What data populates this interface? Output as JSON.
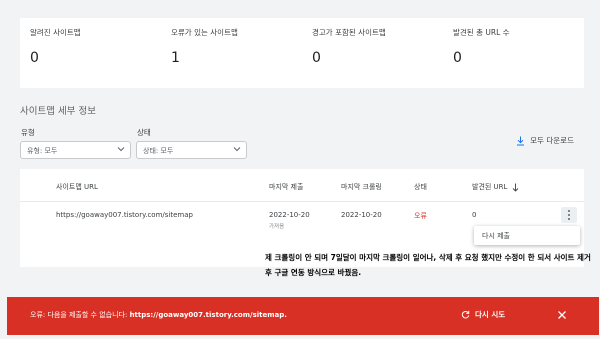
{
  "stats": [
    {
      "label": "알려진 사이트맵",
      "value": "0"
    },
    {
      "label": "오류가 있는 사이트맵",
      "value": "1"
    },
    {
      "label": "경고가 포함된 사이트맵",
      "value": "0"
    },
    {
      "label": "발견된 총 URL 수",
      "value": "0"
    }
  ],
  "section_title": "사이트맵 세부 정보",
  "filters": {
    "type_label": "유형",
    "type_value": "유형: 모두",
    "status_label": "상태",
    "status_value": "상태: 모두"
  },
  "download_label": "모두 다운로드",
  "table": {
    "headers": {
      "url": "사이트맵 URL",
      "submitted": "마지막 제출",
      "crawled": "마지막 크롤링",
      "status": "상태",
      "discovered": "발견된 URL"
    },
    "rows": [
      {
        "url": "https://goaway007.tistory.com/sitemap",
        "submitted": "2022-10-20",
        "submitted_sub": "가져옴",
        "crawled": "2022-10-20",
        "status": "오류",
        "discovered": "0"
      }
    ]
  },
  "row_menu": {
    "item": "다시 제출"
  },
  "note": "제 크롤링이 안 되며 7일달이 마지막 크롤링이 일어나, 삭제 후 요청 했지만 수정이 한 되서 사이트 제거 후 구글 연동 방식으로 바꿨음.",
  "toast": {
    "message_prefix": "오류: 다음을 제출할 수 없습니다: ",
    "message_url": "https://goaway007.tistory.com/sitemap.",
    "retry_label": "다시 시도"
  },
  "colors": {
    "error": "#d93025",
    "background": "#f1f3f4"
  }
}
